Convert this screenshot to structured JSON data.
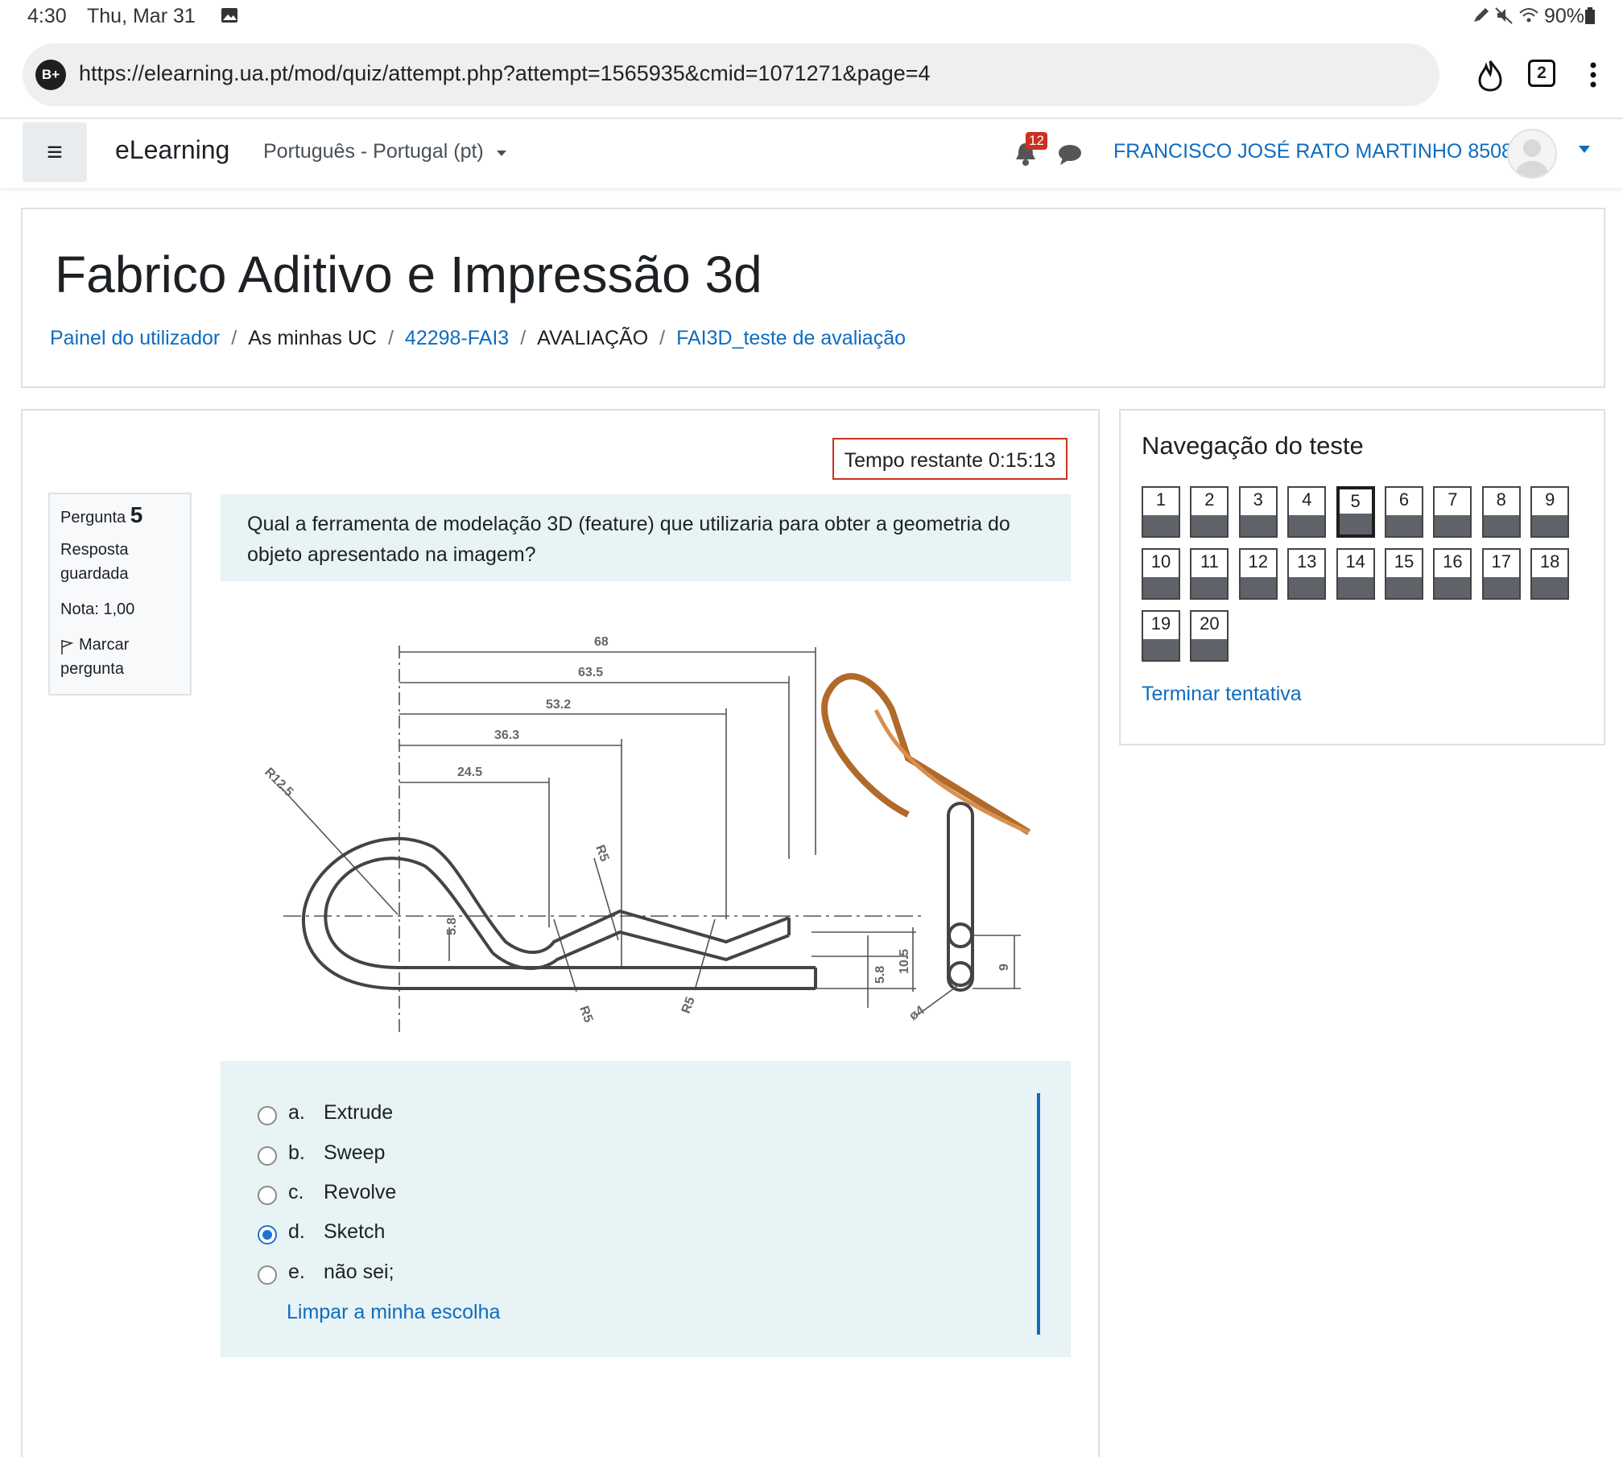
{
  "status_bar": {
    "time": "4:30",
    "date": "Thu, Mar 31",
    "battery": "90%"
  },
  "browser": {
    "badge": "B+",
    "url": "https://elearning.ua.pt/mod/quiz/attempt.php?attempt=1565935&cmid=1071271&page=4",
    "tab_count": "2"
  },
  "navbar": {
    "brand": "eLearning",
    "language": "Português - Portugal (pt)",
    "notification_count": "12",
    "user_name": "FRANCISCO JOSÉ RATO MARTINHO 85088"
  },
  "header": {
    "course_title": "Fabrico Aditivo e Impressão 3d",
    "breadcrumbs": [
      "Painel do utilizador",
      "As minhas UC",
      "42298-FAI3",
      "AVALIAÇÃO",
      "FAI3D_teste de avaliação"
    ]
  },
  "timer": "Tempo restante 0:15:13",
  "question_info": {
    "label": "Pergunta",
    "number": "5",
    "state_line1": "Resposta",
    "state_line2": "guardada",
    "grade": "Nota: 1,00",
    "flag_line1": "Marcar",
    "flag_line2": "pergunta"
  },
  "question": {
    "text": "Qual a ferramenta de modelação 3D (feature) que utilizaria para obter a geometria do objeto apresentado na imagem?",
    "drawing_dims": {
      "d68": "68",
      "d635": "63.5",
      "d532": "53.2",
      "d363": "36.3",
      "d245": "24.5",
      "r125": "R12.5",
      "r5a": "R5",
      "r5b": "R5",
      "r5c": "R5",
      "d58a": "5.8",
      "d58b": "5.8",
      "d105": "10.5",
      "d9": "9",
      "d4": "ø4"
    },
    "answers": [
      {
        "letter": "a.",
        "label": "Extrude",
        "checked": false
      },
      {
        "letter": "b.",
        "label": "Sweep",
        "checked": false
      },
      {
        "letter": "c.",
        "label": "Revolve",
        "checked": false
      },
      {
        "letter": "d.",
        "label": "Sketch",
        "checked": true
      },
      {
        "letter": "e.",
        "label": "não sei;",
        "checked": false
      }
    ],
    "clear_label": "Limpar a minha escolha"
  },
  "quiz_nav": {
    "title": "Navegação do teste",
    "buttons": [
      "1",
      "2",
      "3",
      "4",
      "5",
      "6",
      "7",
      "8",
      "9",
      "10",
      "11",
      "12",
      "13",
      "14",
      "15",
      "16",
      "17",
      "18",
      "19",
      "20"
    ],
    "current": "5",
    "finish_label": "Terminar tentativa"
  }
}
